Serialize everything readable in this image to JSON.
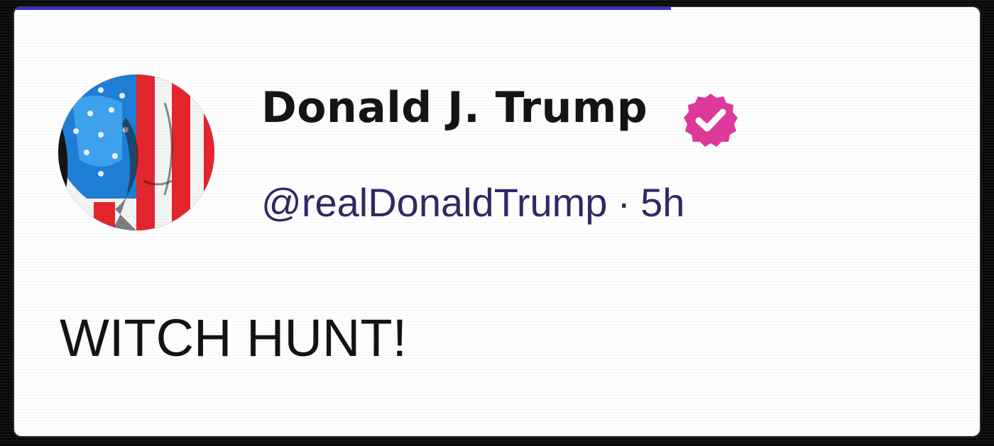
{
  "post": {
    "author": {
      "display_name": "Donald J. Trump",
      "handle": "@realDonaldTrump",
      "avatar_icon": "flag-portrait-avatar",
      "verified_icon": "verified-badge-icon",
      "verified_color": "#e0399c"
    },
    "separator": "·",
    "timestamp": "5h",
    "text": "WITCH HUNT!"
  },
  "progress": {
    "fraction": 0.68,
    "color": "#3b2fe0"
  }
}
